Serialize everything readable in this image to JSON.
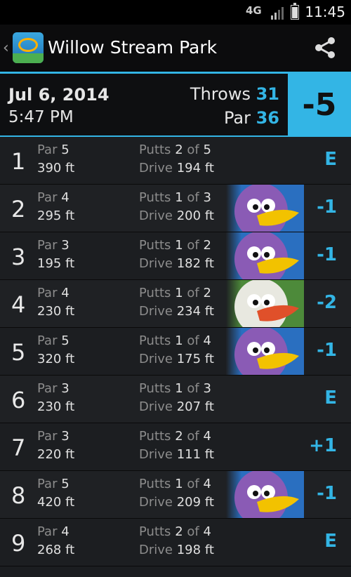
{
  "status_bar": {
    "network": "4G",
    "time": "11:45"
  },
  "action_bar": {
    "title": "Willow Stream Park",
    "share_icon": "share-icon",
    "app_icon": "disc-golf-basket-icon"
  },
  "summary": {
    "date": "Jul 6, 2014",
    "time": "5:47 PM",
    "throws_label": "Throws",
    "throws": "31",
    "par_label": "Par",
    "par": "36",
    "score": "-5",
    "accent": "#33b5e5"
  },
  "labels": {
    "par": "Par",
    "putts": "Putts",
    "of": "of",
    "drive": "Drive"
  },
  "holes": [
    {
      "num": "1",
      "par": "5",
      "dist": "390 ft",
      "putts": "2",
      "putts_total": "5",
      "drive": "194 ft",
      "rel": "E",
      "badge": ""
    },
    {
      "num": "2",
      "par": "4",
      "dist": "295 ft",
      "putts": "1",
      "putts_total": "3",
      "drive": "200 ft",
      "rel": "-1",
      "badge": "birdie"
    },
    {
      "num": "3",
      "par": "3",
      "dist": "195 ft",
      "putts": "1",
      "putts_total": "2",
      "drive": "182 ft",
      "rel": "-1",
      "badge": "birdie"
    },
    {
      "num": "4",
      "par": "4",
      "dist": "230 ft",
      "putts": "1",
      "putts_total": "2",
      "drive": "234 ft",
      "rel": "-2",
      "badge": "eagle"
    },
    {
      "num": "5",
      "par": "5",
      "dist": "320 ft",
      "putts": "1",
      "putts_total": "4",
      "drive": "175 ft",
      "rel": "-1",
      "badge": "birdie"
    },
    {
      "num": "6",
      "par": "3",
      "dist": "230 ft",
      "putts": "1",
      "putts_total": "3",
      "drive": "207 ft",
      "rel": "E",
      "badge": ""
    },
    {
      "num": "7",
      "par": "3",
      "dist": "220 ft",
      "putts": "2",
      "putts_total": "4",
      "drive": "111 ft",
      "rel": "+1",
      "badge": ""
    },
    {
      "num": "8",
      "par": "5",
      "dist": "420 ft",
      "putts": "1",
      "putts_total": "4",
      "drive": "209 ft",
      "rel": "-1",
      "badge": "birdie"
    },
    {
      "num": "9",
      "par": "4",
      "dist": "268 ft",
      "putts": "2",
      "putts_total": "4",
      "drive": "198 ft",
      "rel": "E",
      "badge": ""
    }
  ]
}
